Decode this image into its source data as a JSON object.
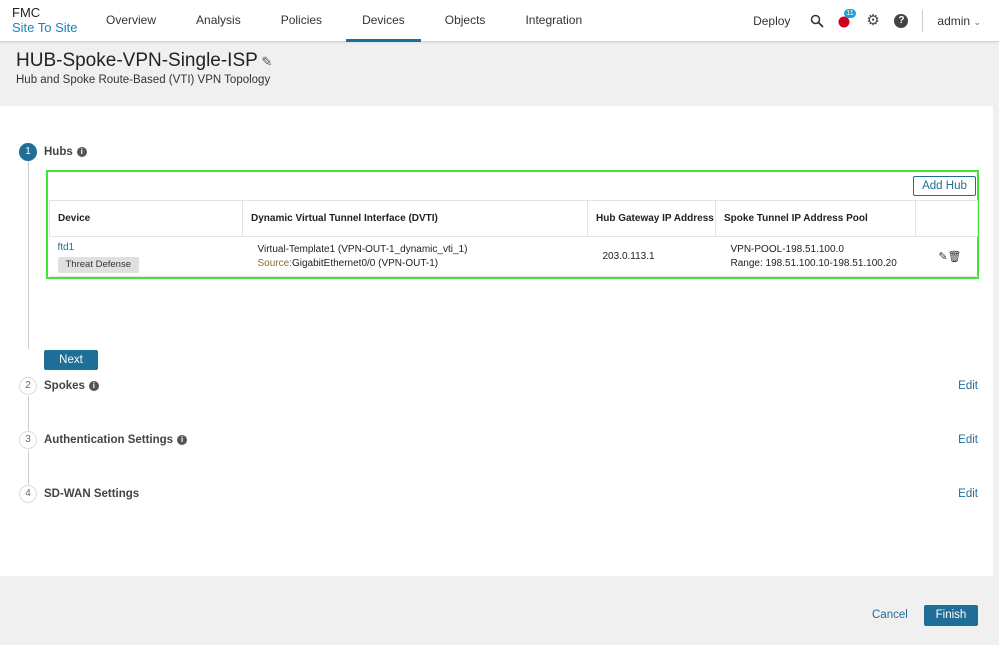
{
  "header": {
    "app": "FMC",
    "section": "Site To Site",
    "nav": [
      "Overview",
      "Analysis",
      "Policies",
      "Devices",
      "Objects",
      "Integration"
    ],
    "active_nav": "Devices",
    "deploy": "Deploy",
    "notification_count": "11",
    "user": "admin"
  },
  "page": {
    "title": "HUB-Spoke-VPN-Single-ISP",
    "subtitle": "Hub and Spoke Route-Based (VTI) VPN Topology"
  },
  "steps": [
    {
      "num": "1",
      "label": "Hubs"
    },
    {
      "num": "2",
      "label": "Spokes",
      "edit": "Edit"
    },
    {
      "num": "3",
      "label": "Authentication Settings",
      "edit": "Edit"
    },
    {
      "num": "4",
      "label": "SD-WAN Settings",
      "edit": "Edit"
    }
  ],
  "hubs": {
    "add_label": "Add Hub",
    "columns": [
      "Device",
      "Dynamic Virtual Tunnel Interface (DVTI)",
      "Hub Gateway IP Address",
      "Spoke Tunnel IP Address Pool"
    ],
    "rows": [
      {
        "device": "ftd1",
        "device_type": "Threat Defense",
        "dvti": "Virtual-Template1 (VPN-OUT-1_dynamic_vti_1)",
        "source_label": "Source:",
        "source": "GigabitEthernet0/0 (VPN-OUT-1)",
        "gateway": "203.0.113.1",
        "pool": "VPN-POOL-198.51.100.0",
        "range": "Range: 198.51.100.10-198.51.100.20"
      }
    ]
  },
  "buttons": {
    "next": "Next",
    "cancel": "Cancel",
    "finish": "Finish"
  }
}
